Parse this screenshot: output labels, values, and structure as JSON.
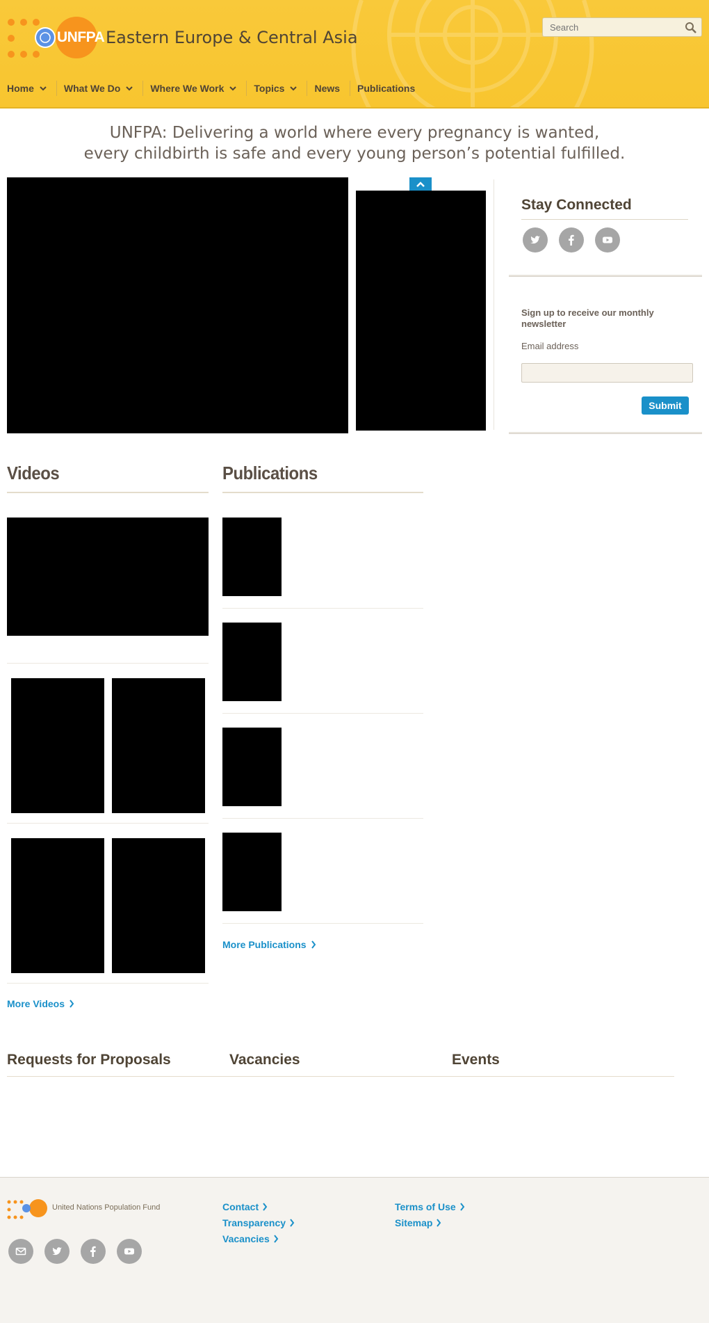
{
  "header": {
    "brand": "UNFPA",
    "region_title": "Eastern Europe & Central Asia",
    "search_placeholder": "Search",
    "nav": [
      {
        "label": "Home",
        "has_dropdown": true
      },
      {
        "label": "What We Do",
        "has_dropdown": true
      },
      {
        "label": "Where We Work",
        "has_dropdown": true
      },
      {
        "label": "Topics",
        "has_dropdown": true
      },
      {
        "label": "News",
        "has_dropdown": false
      },
      {
        "label": "Publications",
        "has_dropdown": false
      }
    ]
  },
  "tagline": {
    "line1": "UNFPA: Delivering a world where every pregnancy is wanted,",
    "line2": "every childbirth is safe and every young person’s potential fulfilled."
  },
  "sidebar": {
    "stay_connected": "Stay Connected",
    "social": [
      "twitter-icon",
      "facebook-icon",
      "youtube-icon"
    ],
    "newsletter_heading": "Sign up to receive our monthly newsletter",
    "email_label": "Email address",
    "submit_label": "Submit"
  },
  "videos": {
    "heading": "Videos",
    "more": "More Videos"
  },
  "publications": {
    "heading": "Publications",
    "more": "More Publications"
  },
  "lower": {
    "rfp": "Requests for Proposals",
    "vacancies": "Vacancies",
    "events": "Events"
  },
  "footer": {
    "org_name": "United Nations Population Fund",
    "links_col1": [
      "Contact",
      "Transparency",
      "Vacancies"
    ],
    "links_col2": [
      "Terms of Use",
      "Sitemap"
    ],
    "social": [
      "mail-icon",
      "twitter-icon",
      "facebook-icon",
      "youtube-icon"
    ]
  },
  "colors": {
    "header_yellow": "#f8c52f",
    "accent_blue": "#1a90c9",
    "brand_orange": "#f7941d",
    "text_brown": "#4f4435"
  }
}
